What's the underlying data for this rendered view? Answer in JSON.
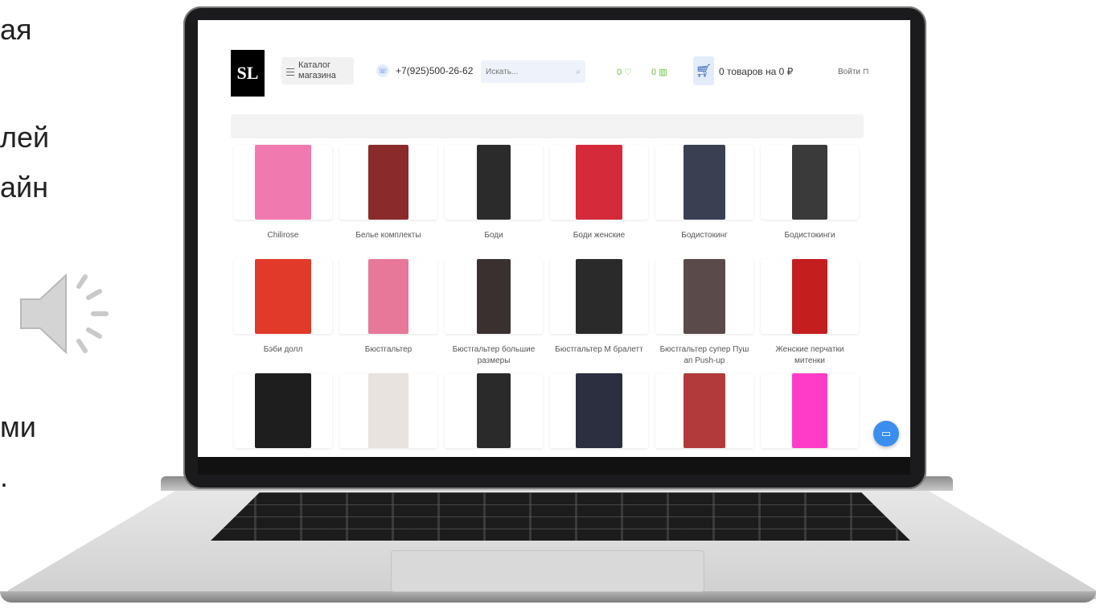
{
  "slide": {
    "fragments": [
      "ая",
      "лей",
      "айн",
      "ми",
      "."
    ]
  },
  "site": {
    "logo": "SL",
    "catalog_label": "Каталог магазина",
    "phone": "+7(925)500-26-62",
    "search_placeholder": "Искать...",
    "favorites_count": "0",
    "compare_count": "0",
    "cart_summary": "0 товаров на 0 ₽",
    "login_label": "Войти"
  },
  "categories": [
    {
      "label": "Chilirose",
      "thumb": "#f07ab0"
    },
    {
      "label": "Белье комплекты",
      "thumb": "#8a2a2a"
    },
    {
      "label": "Боди",
      "thumb": "#2b2b2b"
    },
    {
      "label": "Боди женские",
      "thumb": "#d42a3a"
    },
    {
      "label": "Бодистокинг",
      "thumb": "#3a3f52"
    },
    {
      "label": "Бодистокинги",
      "thumb": "#3a3a3a"
    },
    {
      "label": "Бэби долл",
      "thumb": "#e23a2a"
    },
    {
      "label": "Бюстгальтер",
      "thumb": "#e7789a"
    },
    {
      "label": "Бюстгальтер большие размеры",
      "thumb": "#3a3030"
    },
    {
      "label": "Бюстгальтер М бралетт",
      "thumb": "#2a2a2a"
    },
    {
      "label": "Бюстгальтер супер Пуш ап Push-up",
      "thumb": "#5a4a4a"
    },
    {
      "label": "Женские перчатки митенки",
      "thumb": "#c41e1e"
    },
    {
      "label": "",
      "thumb": "#1e1e1e"
    },
    {
      "label": "",
      "thumb": "#e9e3df"
    },
    {
      "label": "",
      "thumb": "#2a2a2a"
    },
    {
      "label": "",
      "thumb": "#2b2f40"
    },
    {
      "label": "",
      "thumb": "#b33a3a"
    },
    {
      "label": "",
      "thumb": "#ff3cc8"
    }
  ]
}
